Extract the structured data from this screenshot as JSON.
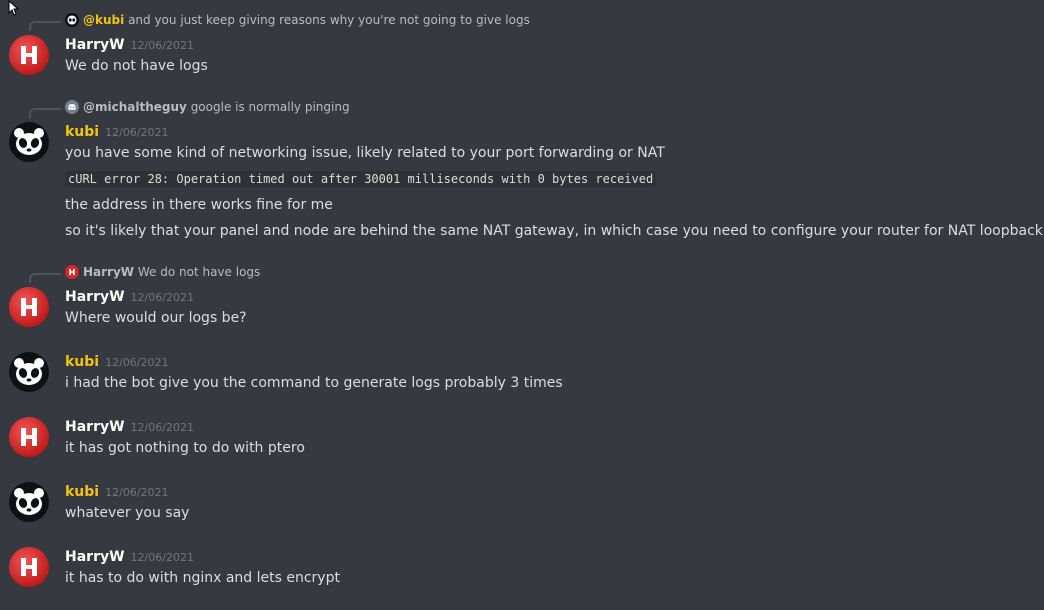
{
  "messages": [
    {
      "reply": {
        "mention": "@kubi",
        "text": "and you just keep giving reasons why you're not going to give logs"
      },
      "author": "HarryW",
      "timestamp": "12/06/2021",
      "lines": [
        "We do not have logs"
      ]
    },
    {
      "reply": {
        "mention": "@michaltheguy",
        "text": "google is normally pinging"
      },
      "author": "kubi",
      "timestamp": "12/06/2021",
      "lines": [
        "you have some kind of networking issue, likely related to your port forwarding or NAT",
        "cURL error 28: Operation timed out after 30001 milliseconds with 0 bytes received",
        "the address in there works fine for me",
        "so it's likely that your panel and node are behind the same NAT gateway, in which case you need to configure your router for NAT loopback"
      ]
    },
    {
      "reply": {
        "mention": "HarryW",
        "text": "We do not have logs"
      },
      "author": "HarryW",
      "timestamp": "12/06/2021",
      "lines": [
        "Where would our logs be?"
      ]
    },
    {
      "author": "kubi",
      "timestamp": "12/06/2021",
      "lines": [
        "i had the bot give you the command to generate logs probably 3 times"
      ]
    },
    {
      "author": "HarryW",
      "timestamp": "12/06/2021",
      "lines": [
        "it has got nothing to do with ptero"
      ]
    },
    {
      "author": "kubi",
      "timestamp": "12/06/2021",
      "lines": [
        "whatever you say"
      ]
    },
    {
      "author": "HarryW",
      "timestamp": "12/06/2021",
      "lines": [
        "it has to do with nginx and lets encrypt"
      ]
    }
  ],
  "colors": {
    "background": "#36393f",
    "kubi_name": "#f1c40f",
    "harry_name": "#ffffff",
    "timestamp": "#72767d",
    "text": "#dcddde"
  },
  "icons": {
    "harry_avatar": "red-h-avatar-icon",
    "kubi_avatar": "panda-avatar-icon",
    "discord_default_avatar": "discord-logo-icon"
  }
}
